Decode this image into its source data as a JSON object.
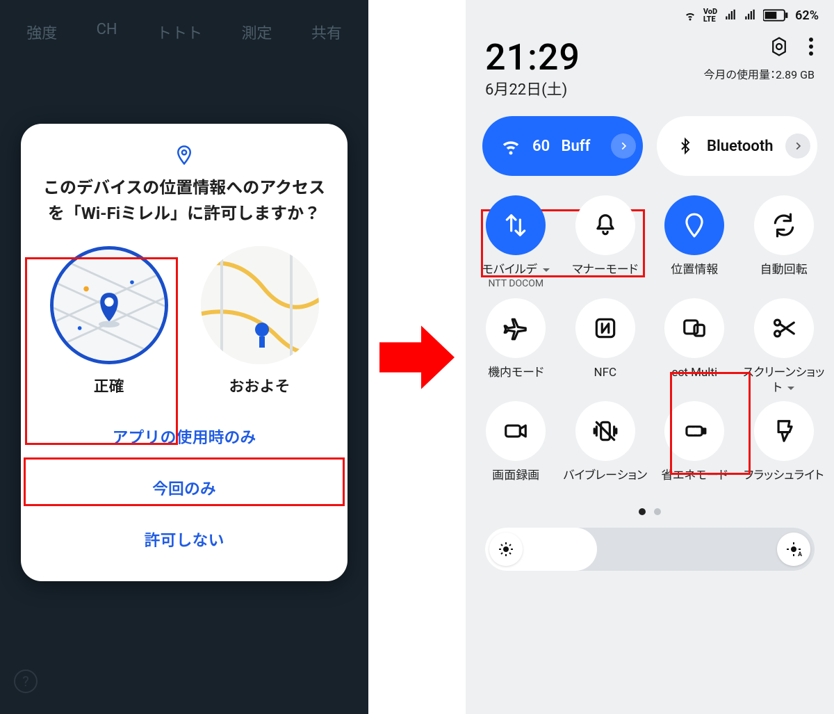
{
  "left": {
    "bg_tabs": [
      "強度",
      "CH",
      "トトト",
      "測定",
      "共有"
    ],
    "dialog_title": "このデバイスの位置情報へのアクセスを「Wi-Fiミレル」に許可しますか？",
    "choices": {
      "precise": "正確",
      "approx": "おおよそ"
    },
    "buttons": {
      "while_using": "アプリの使用時のみ",
      "once": "今回のみ",
      "deny": "許可しない"
    }
  },
  "right": {
    "status": {
      "battery_pct": "62%"
    },
    "clock": "21:29",
    "date": "6月22日(土)",
    "usage_label": "今月の使用量：",
    "usage_value": "2.89 GB",
    "big_tiles": {
      "wifi": {
        "value": "60",
        "ssid": "Buff"
      },
      "bluetooth": "Bluetooth"
    },
    "tiles": [
      {
        "id": "mobile",
        "label": "モバイルデ",
        "sub": "NTT DOCOM",
        "on": true,
        "icon": "swap"
      },
      {
        "id": "manner",
        "label": "マナーモード",
        "sub": "",
        "on": false,
        "icon": "bell"
      },
      {
        "id": "location",
        "label": "位置情報",
        "sub": "",
        "on": true,
        "icon": "pin"
      },
      {
        "id": "rotate",
        "label": "自動回転",
        "sub": "",
        "on": false,
        "icon": "rotate"
      },
      {
        "id": "airplane",
        "label": "機内モード",
        "sub": "",
        "on": false,
        "icon": "plane"
      },
      {
        "id": "nfc",
        "label": "NFC",
        "sub": "",
        "on": false,
        "icon": "nfc"
      },
      {
        "id": "multi",
        "label": "ect Multi",
        "sub": "",
        "on": false,
        "icon": "multi"
      },
      {
        "id": "screenshot",
        "label": "スクリーンショット",
        "sub": "",
        "on": false,
        "icon": "scissors"
      },
      {
        "id": "record",
        "label": "画面録画",
        "sub": "",
        "on": false,
        "icon": "record"
      },
      {
        "id": "vibrate",
        "label": "バイブレーション",
        "sub": "",
        "on": false,
        "icon": "vibrate"
      },
      {
        "id": "eco",
        "label": "省エネモード",
        "sub": "",
        "on": false,
        "icon": "eco"
      },
      {
        "id": "flash",
        "label": "フラッシュライト",
        "sub": "",
        "on": false,
        "icon": "flash"
      }
    ],
    "brightness_pct": 34
  }
}
